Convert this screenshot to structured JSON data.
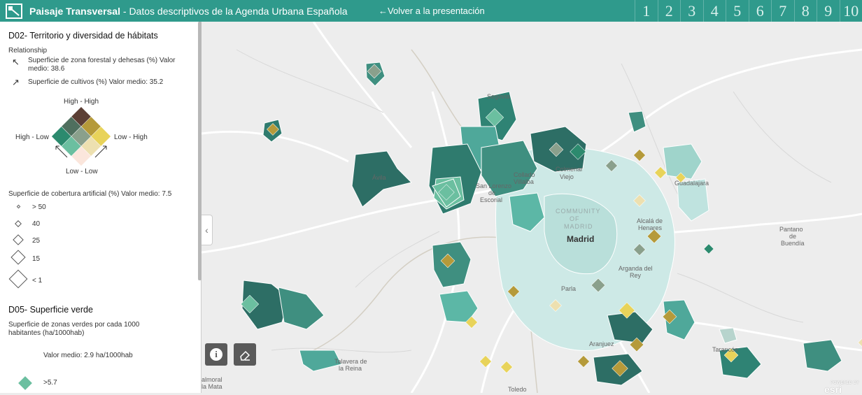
{
  "header": {
    "app_name": "Paisaje Transversal",
    "subtitle": " - Datos descriptivos de la Agenda Urbana Española",
    "back_link": "←Volver a la presentación",
    "pages": [
      "1",
      "2",
      "3",
      "4",
      "5",
      "6",
      "7",
      "8",
      "9",
      "10"
    ]
  },
  "legend_d02": {
    "title": "D02- Territorio y diversidad de hábitats",
    "relationship": "Relationship",
    "var1": "Superficie de zona forestal y dehesas (%) Valor medio: 38.6",
    "var2": "Superficie de cultivos (%) Valor medio: 35.2",
    "corner_top": "High - High",
    "corner_left": "High - Low",
    "corner_right": "Low - High",
    "corner_bottom": "Low - Low",
    "size_title": "Superficie de cobertura artificial (%) Valor medio: 7.5",
    "size_classes": [
      "> 50",
      "40",
      "25",
      "15",
      "< 1"
    ],
    "colors": {
      "hh": "#5c3f35",
      "hm": "#4f6f5e",
      "hl": "#2c8a6e",
      "mh": "#b59a3a",
      "mm": "#8aa08c",
      "ml": "#6bbfa0",
      "lh": "#e8d35a",
      "lm": "#ede0b0",
      "ll": "#fbe6dc"
    }
  },
  "legend_d05": {
    "title": "D05- Superficie verde",
    "desc": "Superficie de zonas verdes por cada 1000 habitantes (ha/1000hab)",
    "avg": "Valor medio: 2.9 ha/1000hab",
    "first_class": ">5.7"
  },
  "map": {
    "labels": {
      "segovia": "Segovia",
      "avila": "Ávila",
      "colmenar": "Colmenar",
      "viejo": "Viejo",
      "collado": "Collado",
      "villalba": "Villalba",
      "san_lorenzo": "San Lorenzo",
      "de": "de",
      "escorial": "Escorial",
      "community": "COMMUNITY",
      "of": "OF",
      "madrid_region": "MADRID",
      "madrid": "Madrid",
      "alcala": "Alcalá de",
      "henares": "Henares",
      "guadalajara": "Guadalajara",
      "arganda": "Arganda del",
      "rey": "Rey",
      "parla": "Parla",
      "aranjuez": "Aranjuez",
      "talavera": "Talavera de",
      "la_reina": "la Reina",
      "almoral": "almoral",
      "la_mata": "la Mata",
      "toledo": "Toledo",
      "tarancon": "Tarancón",
      "pantano": "Pantano",
      "de2": "de",
      "buendia": "Buendía"
    },
    "attribution": "esri",
    "powered": "POWERED BY"
  }
}
